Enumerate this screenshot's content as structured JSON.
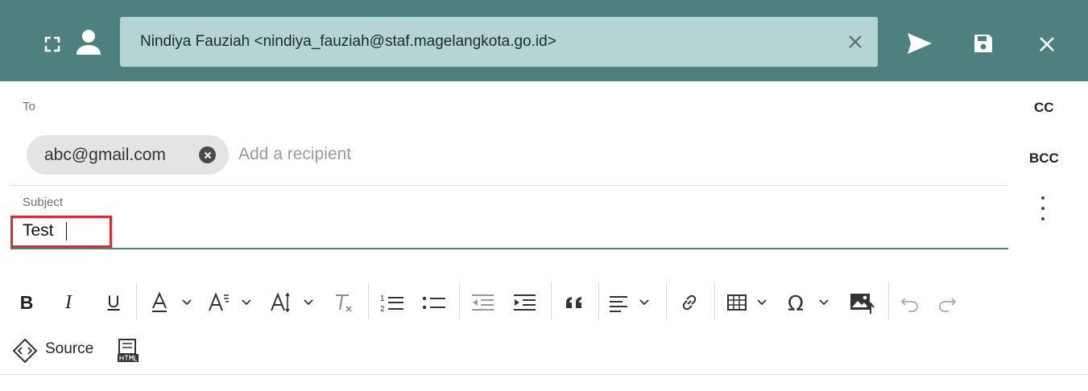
{
  "header": {
    "from_value": "Nindiya Fauziah <nindiya_fauziah@staf.magelangkota.go.id>",
    "icons": [
      "expand-icon",
      "user-icon",
      "clear-icon",
      "send-icon",
      "save-icon",
      "close-icon"
    ]
  },
  "to": {
    "label": "To",
    "chip_email": "abc@gmail.com",
    "placeholder": "Add a recipient"
  },
  "side": {
    "cc": "CC",
    "bcc": "BCC"
  },
  "subject": {
    "label": "Subject",
    "value": "Test "
  },
  "toolbar": {
    "source_label": "Source",
    "buttons": [
      "bold",
      "italic",
      "underline",
      "font-color",
      "font-size",
      "text-size",
      "clear-formatting",
      "numbered-list",
      "bulleted-list",
      "outdent",
      "indent",
      "blockquote",
      "align",
      "link",
      "table",
      "special-characters",
      "insert-image",
      "undo",
      "redo",
      "source",
      "html-embed"
    ]
  },
  "colors": {
    "header_bg": "#4d807e",
    "from_bg": "#b4d5d3",
    "highlight": "#e8262b",
    "accent_line": "#4d807e"
  }
}
